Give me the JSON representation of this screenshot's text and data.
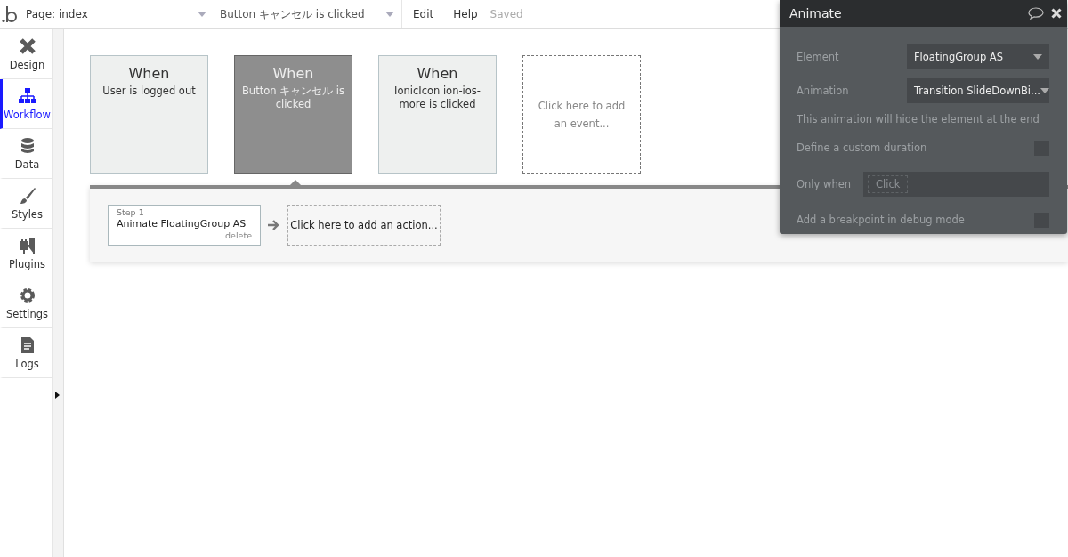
{
  "topbar": {
    "page_dropdown": "Page: index",
    "event_dropdown": "Button キャンセル is clicked",
    "menu": [
      "Edit",
      "Help"
    ],
    "save_status": "Saved"
  },
  "sidebar": {
    "items": [
      {
        "label": "Design",
        "selected": false
      },
      {
        "label": "Workflow",
        "selected": true
      },
      {
        "label": "Data",
        "selected": false
      },
      {
        "label": "Styles",
        "selected": false
      },
      {
        "label": "Plugins",
        "selected": false
      },
      {
        "label": "Settings",
        "selected": false
      },
      {
        "label": "Logs",
        "selected": false
      }
    ]
  },
  "events": [
    {
      "kind": "event",
      "heading": "When",
      "text": "User is logged out",
      "selected": false
    },
    {
      "kind": "event",
      "heading": "When",
      "text": "Button キャンセル is clicked",
      "selected": true
    },
    {
      "kind": "event",
      "heading": "When",
      "text": "IonicIcon ion-ios-more is clicked",
      "selected": false
    },
    {
      "kind": "add",
      "text": "Click here to add an event..."
    }
  ],
  "actions": [
    {
      "kind": "step",
      "step": "Step 1",
      "text": "Animate FloatingGroup AS",
      "delete": "delete"
    },
    {
      "kind": "add",
      "text": "Click here to add an action..."
    }
  ],
  "property_panel": {
    "title": "Animate",
    "rows": [
      {
        "kind": "dropdown",
        "label": "Element",
        "value": "FloatingGroup AS"
      },
      {
        "kind": "dropdown",
        "label": "Animation",
        "value": "Transition SlideDownBi..."
      },
      {
        "kind": "note",
        "text": "This animation will hide the element at the end"
      },
      {
        "kind": "checkbox",
        "label": "Define a custom duration",
        "checked": false
      },
      {
        "kind": "condition",
        "label": "Only when",
        "placeholder": "Click"
      },
      {
        "kind": "checkbox",
        "label": "Add a breakpoint in debug mode",
        "checked": false
      }
    ]
  }
}
